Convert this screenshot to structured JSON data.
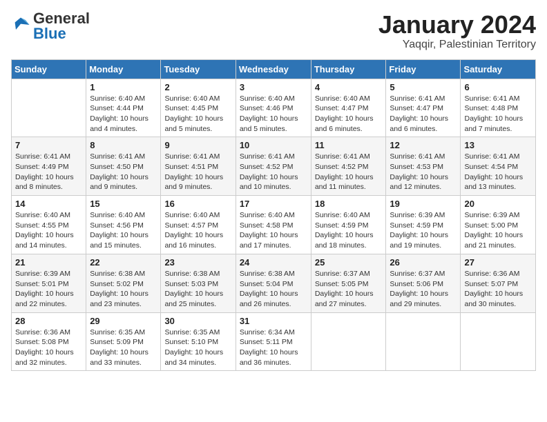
{
  "header": {
    "logo_general": "General",
    "logo_blue": "Blue",
    "month_title": "January 2024",
    "location": "Yaqqir, Palestinian Territory"
  },
  "days_of_week": [
    "Sunday",
    "Monday",
    "Tuesday",
    "Wednesday",
    "Thursday",
    "Friday",
    "Saturday"
  ],
  "weeks": [
    [
      {
        "day": "",
        "info": ""
      },
      {
        "day": "1",
        "info": "Sunrise: 6:40 AM\nSunset: 4:44 PM\nDaylight: 10 hours\nand 4 minutes."
      },
      {
        "day": "2",
        "info": "Sunrise: 6:40 AM\nSunset: 4:45 PM\nDaylight: 10 hours\nand 5 minutes."
      },
      {
        "day": "3",
        "info": "Sunrise: 6:40 AM\nSunset: 4:46 PM\nDaylight: 10 hours\nand 5 minutes."
      },
      {
        "day": "4",
        "info": "Sunrise: 6:40 AM\nSunset: 4:47 PM\nDaylight: 10 hours\nand 6 minutes."
      },
      {
        "day": "5",
        "info": "Sunrise: 6:41 AM\nSunset: 4:47 PM\nDaylight: 10 hours\nand 6 minutes."
      },
      {
        "day": "6",
        "info": "Sunrise: 6:41 AM\nSunset: 4:48 PM\nDaylight: 10 hours\nand 7 minutes."
      }
    ],
    [
      {
        "day": "7",
        "info": "Sunrise: 6:41 AM\nSunset: 4:49 PM\nDaylight: 10 hours\nand 8 minutes."
      },
      {
        "day": "8",
        "info": "Sunrise: 6:41 AM\nSunset: 4:50 PM\nDaylight: 10 hours\nand 9 minutes."
      },
      {
        "day": "9",
        "info": "Sunrise: 6:41 AM\nSunset: 4:51 PM\nDaylight: 10 hours\nand 9 minutes."
      },
      {
        "day": "10",
        "info": "Sunrise: 6:41 AM\nSunset: 4:52 PM\nDaylight: 10 hours\nand 10 minutes."
      },
      {
        "day": "11",
        "info": "Sunrise: 6:41 AM\nSunset: 4:52 PM\nDaylight: 10 hours\nand 11 minutes."
      },
      {
        "day": "12",
        "info": "Sunrise: 6:41 AM\nSunset: 4:53 PM\nDaylight: 10 hours\nand 12 minutes."
      },
      {
        "day": "13",
        "info": "Sunrise: 6:41 AM\nSunset: 4:54 PM\nDaylight: 10 hours\nand 13 minutes."
      }
    ],
    [
      {
        "day": "14",
        "info": "Sunrise: 6:40 AM\nSunset: 4:55 PM\nDaylight: 10 hours\nand 14 minutes."
      },
      {
        "day": "15",
        "info": "Sunrise: 6:40 AM\nSunset: 4:56 PM\nDaylight: 10 hours\nand 15 minutes."
      },
      {
        "day": "16",
        "info": "Sunrise: 6:40 AM\nSunset: 4:57 PM\nDaylight: 10 hours\nand 16 minutes."
      },
      {
        "day": "17",
        "info": "Sunrise: 6:40 AM\nSunset: 4:58 PM\nDaylight: 10 hours\nand 17 minutes."
      },
      {
        "day": "18",
        "info": "Sunrise: 6:40 AM\nSunset: 4:59 PM\nDaylight: 10 hours\nand 18 minutes."
      },
      {
        "day": "19",
        "info": "Sunrise: 6:39 AM\nSunset: 4:59 PM\nDaylight: 10 hours\nand 19 minutes."
      },
      {
        "day": "20",
        "info": "Sunrise: 6:39 AM\nSunset: 5:00 PM\nDaylight: 10 hours\nand 21 minutes."
      }
    ],
    [
      {
        "day": "21",
        "info": "Sunrise: 6:39 AM\nSunset: 5:01 PM\nDaylight: 10 hours\nand 22 minutes."
      },
      {
        "day": "22",
        "info": "Sunrise: 6:38 AM\nSunset: 5:02 PM\nDaylight: 10 hours\nand 23 minutes."
      },
      {
        "day": "23",
        "info": "Sunrise: 6:38 AM\nSunset: 5:03 PM\nDaylight: 10 hours\nand 25 minutes."
      },
      {
        "day": "24",
        "info": "Sunrise: 6:38 AM\nSunset: 5:04 PM\nDaylight: 10 hours\nand 26 minutes."
      },
      {
        "day": "25",
        "info": "Sunrise: 6:37 AM\nSunset: 5:05 PM\nDaylight: 10 hours\nand 27 minutes."
      },
      {
        "day": "26",
        "info": "Sunrise: 6:37 AM\nSunset: 5:06 PM\nDaylight: 10 hours\nand 29 minutes."
      },
      {
        "day": "27",
        "info": "Sunrise: 6:36 AM\nSunset: 5:07 PM\nDaylight: 10 hours\nand 30 minutes."
      }
    ],
    [
      {
        "day": "28",
        "info": "Sunrise: 6:36 AM\nSunset: 5:08 PM\nDaylight: 10 hours\nand 32 minutes."
      },
      {
        "day": "29",
        "info": "Sunrise: 6:35 AM\nSunset: 5:09 PM\nDaylight: 10 hours\nand 33 minutes."
      },
      {
        "day": "30",
        "info": "Sunrise: 6:35 AM\nSunset: 5:10 PM\nDaylight: 10 hours\nand 34 minutes."
      },
      {
        "day": "31",
        "info": "Sunrise: 6:34 AM\nSunset: 5:11 PM\nDaylight: 10 hours\nand 36 minutes."
      },
      {
        "day": "",
        "info": ""
      },
      {
        "day": "",
        "info": ""
      },
      {
        "day": "",
        "info": ""
      }
    ]
  ]
}
